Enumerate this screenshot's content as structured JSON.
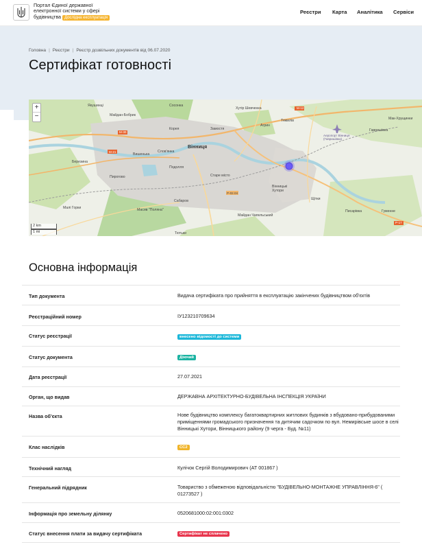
{
  "header": {
    "brand_line1": "Портал Єдиної державної",
    "brand_line2": "електронної системи у сфері",
    "brand_line3": "будівництва",
    "beta_badge": "Дослідна експлуатація",
    "nav": [
      "Реєстри",
      "Карта",
      "Аналітика",
      "Сервіси"
    ]
  },
  "breadcrumbs": [
    "Головна",
    "Реєстри",
    "Реєстр дозвільних документів від 06.07.2020"
  ],
  "page_title": "Сертифікат готовності",
  "map": {
    "zoom_in": "+",
    "zoom_out": "−",
    "scale_km": "2 km",
    "scale_mi": "1 mi",
    "labels": [
      "Якушинці",
      "Сосонка",
      "Хутір Шевченка",
      "М-12",
      "Майдан-Бобрик",
      "Тяжилів",
      "Агрин",
      "Мак-Хрущинки",
      "М-30",
      "Корея",
      "Замостя",
      "Аеропорт Вінниця (Гавришівка)",
      "Гавришівка",
      "Вишенька",
      "Слов'янка",
      "Вінниця",
      "М-21",
      "Березина",
      "Подолля",
      "Старе місто",
      "Пирогово",
      "Вінницькі Хутори",
      "Р-02.04",
      "Щітки",
      "Сабаров",
      "Майдан Чапельський",
      "Писарівка",
      "Малі Горки",
      "Масив \"Поляна\"",
      "Гуменне",
      "Тютьки",
      "Р-17"
    ],
    "marker_color": "#6b5cf6"
  },
  "section_title": "Основна інформація",
  "rows": [
    {
      "label": "Тип документа",
      "value": "Видача сертифіката про прийняття в експлуатацію закінчених будівництвом об'єктів"
    },
    {
      "label": "Реєстраційний номер",
      "value": "ІУ123210709634"
    },
    {
      "label": "Статус реєстрації",
      "value": "внесено відомості до системи",
      "pill": "#1cb7d9"
    },
    {
      "label": "Статус документа",
      "value": "Діючий",
      "pill": "#1bb3a2"
    },
    {
      "label": "Дата реєстрації",
      "value": "27.07.2021"
    },
    {
      "label": "Орган, що видав",
      "value": "ДЕРЖАВНА АРХІТЕКТУРНО-БУДІВЕЛЬНА ІНСПЕКЦІЯ УКРАЇНИ"
    },
    {
      "label": "Назва об'єкта",
      "value": "Нове будівництво комплексу багатоквартирних житлових будинків з вбудовано-прибудованими приміщеннями громадського призначення та дитячим садочком по вул. Немирівське шосе в селі Вінницькі Хутори, Вінницького району (9 черга - Буд. №11)"
    },
    {
      "label": "Клас наслідків",
      "value": "СС2",
      "pill": "#f0b429"
    },
    {
      "label": "Технічний нагляд",
      "value": "Кулічок Сергій Володимирович (АТ 001867 )"
    },
    {
      "label": "Генеральний підрядник",
      "value": "Товариство з обмеженою відповідальністю \"БУДІВЕЛЬНО-МОНТАЖНЕ УПРАВЛІННЯ-6\" ( 01273527 )"
    },
    {
      "label": "Інформація про земельну ділянку",
      "value": "0520681000:02:001:0302"
    },
    {
      "label": "Статус внесення плати за видачу сертифіката",
      "value": "Сертифікат не сплачено",
      "pill": "#e8354d"
    }
  ]
}
